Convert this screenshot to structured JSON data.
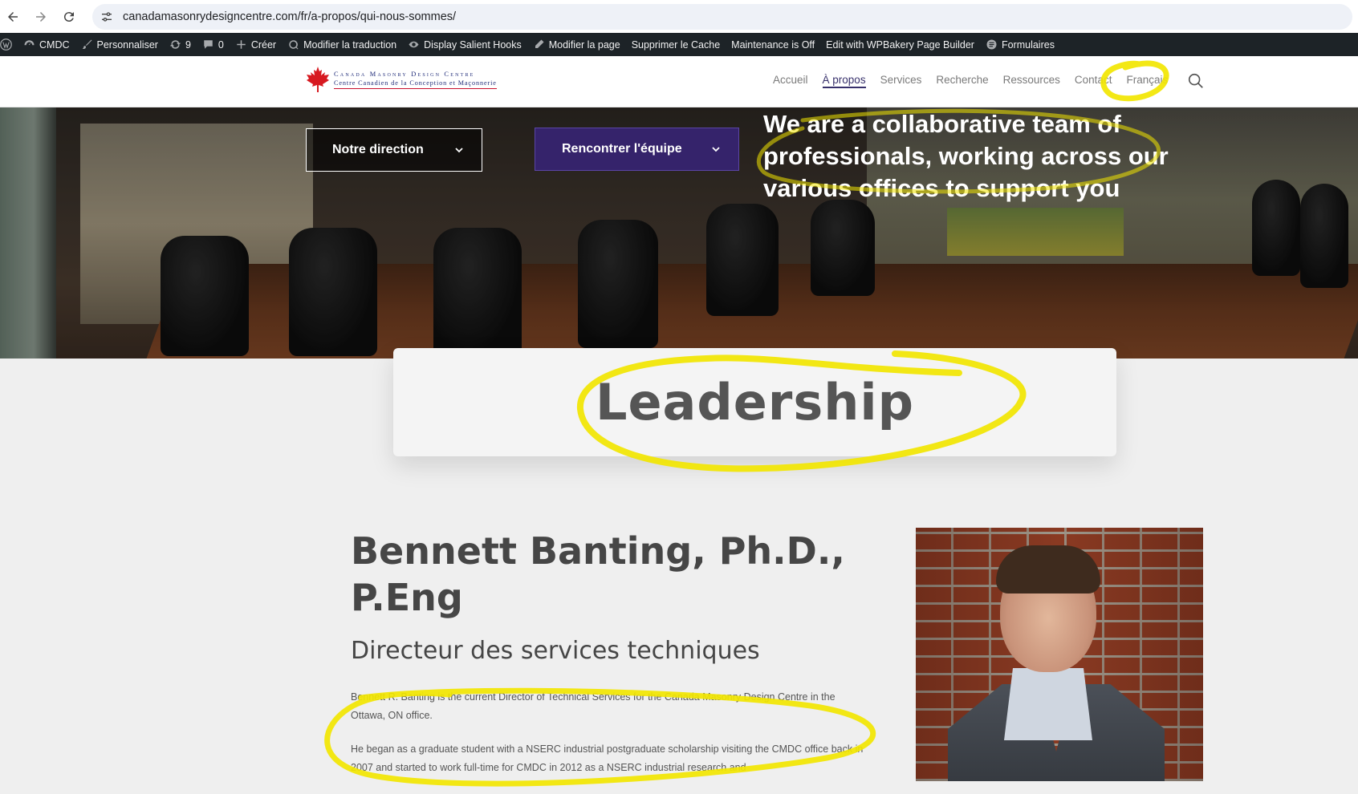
{
  "browser": {
    "url": "canadamasonrydesigncentre.com/fr/a-propos/qui-nous-sommes/"
  },
  "admin_bar": {
    "site": "CMDC",
    "customize": "Personnaliser",
    "updates": "9",
    "comments": "0",
    "create": "Créer",
    "edit_translation": "Modifier la traduction",
    "hooks": "Display Salient Hooks",
    "edit_page": "Modifier la page",
    "clear_cache": "Supprimer le Cache",
    "maintenance": "Maintenance is Off",
    "wpbakery": "Edit with WPBakery Page Builder",
    "forms": "Formulaires"
  },
  "header": {
    "logo_line1": "Canada Masonry Design Centre",
    "logo_line2": "Centre Canadien de la Conception et Maçonnerie",
    "nav": [
      "Accueil",
      "À propos",
      "Services",
      "Recherche",
      "Ressources",
      "Contact",
      "Français"
    ]
  },
  "hero": {
    "button_direction": "Notre direction",
    "button_team": "Rencontrer l'équipe",
    "headline": "We are a collaborative team of professionals, working across our various offices to support you"
  },
  "section": {
    "title": "Leadership"
  },
  "profile": {
    "name": "Bennett Banting, Ph.D., P.Eng",
    "role": "Directeur des services techniques",
    "bio": [
      "Bennett R. Banting is the current Director of Technical Services for the Canada Masonry Design Centre in the Ottawa, ON office.",
      "He began as a graduate student with a NSERC industrial postgraduate scholarship visiting the CMDC office back in 2007 and started to work full-time for CMDC in 2012 as a NSERC industrial research and"
    ]
  },
  "colors": {
    "annotation": "#f2e600",
    "accent": "#35236b",
    "admin_bar": "#1d2327"
  }
}
